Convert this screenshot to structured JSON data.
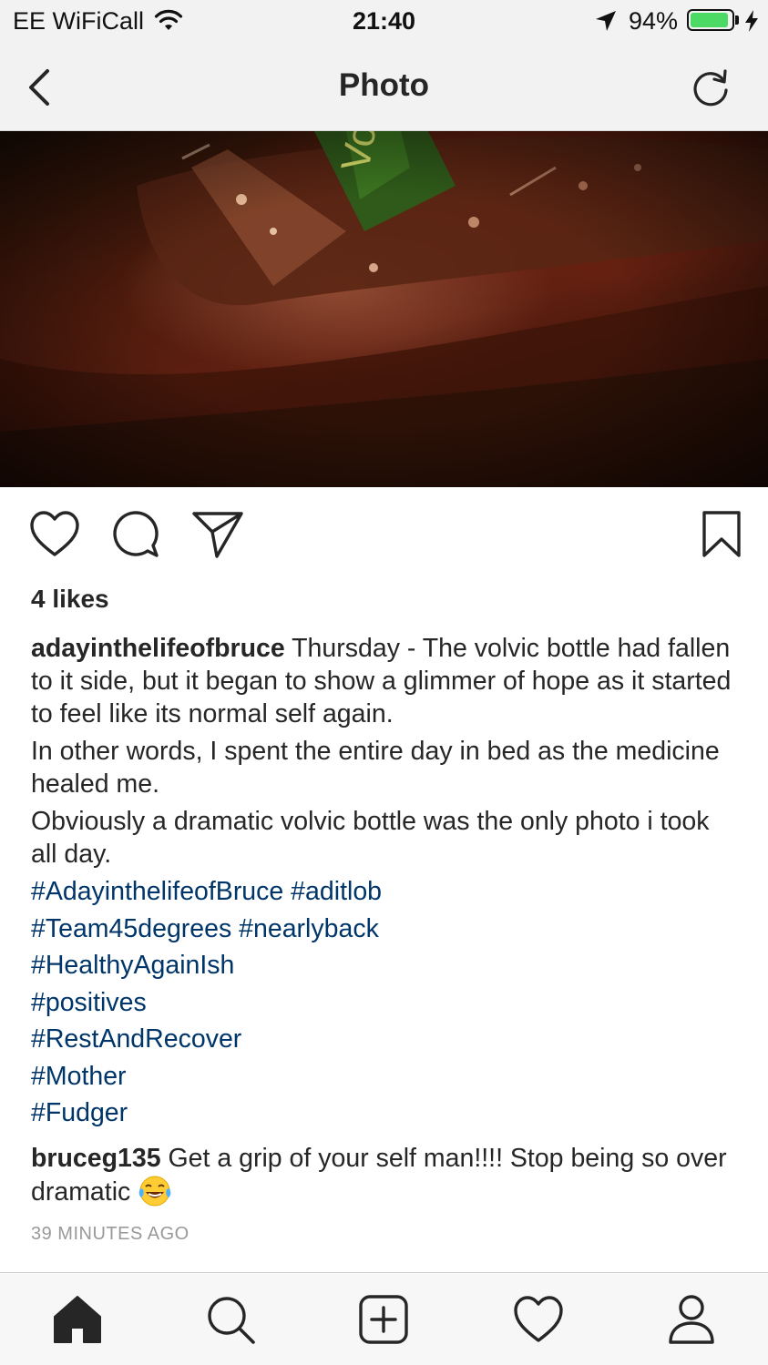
{
  "status_bar": {
    "carrier": "EE WiFiCall",
    "time": "21:40",
    "battery_percent": "94%",
    "battery_level": 0.94,
    "icons": [
      "wifi-icon",
      "location-arrow-icon",
      "battery-icon",
      "charging-bolt-icon"
    ]
  },
  "nav": {
    "title": "Photo",
    "back_icon": "chevron-left-icon",
    "refresh_icon": "refresh-icon"
  },
  "post": {
    "likes": "4 likes",
    "actions": [
      "heart-icon",
      "comment-icon",
      "share-icon",
      "bookmark-icon"
    ],
    "caption": {
      "username": "adayinthelifeofbruce",
      "paragraph1": " Thursday - The volvic bottle had fallen to it side, but it began to show a glimmer of hope as it started to feel like its normal self again.",
      "paragraph2": "In other words, I spent the entire day in bed as the medicine healed me.",
      "paragraph3": "Obviously a dramatic volvic bottle was the only photo i took all day."
    },
    "hashtags": {
      "line1": "#AdayinthelifeofBruce #aditlob",
      "line2": "#Team45degrees #nearlyback",
      "line3": "#HealthyAgainIsh",
      "line4": "#positives",
      "line5": "#RestAndRecover",
      "line6": "#Mother",
      "line7": "#Fudger"
    },
    "comment": {
      "username": "bruceg135",
      "text": " Get a grip of your self man!!!! Stop being so over dramatic ",
      "emoji": "laughing-tears-emoji"
    },
    "timestamp": "39 MINUTES AGO"
  },
  "tab_bar": {
    "items": [
      "home-icon",
      "search-icon",
      "new-post-icon",
      "activity-heart-icon",
      "profile-icon"
    ],
    "active": "home-icon"
  },
  "colors": {
    "hashtag": "#003569",
    "text": "#262626",
    "muted": "#999999",
    "battery": "#4cd964",
    "bar_bg": "#f2f2f2"
  }
}
